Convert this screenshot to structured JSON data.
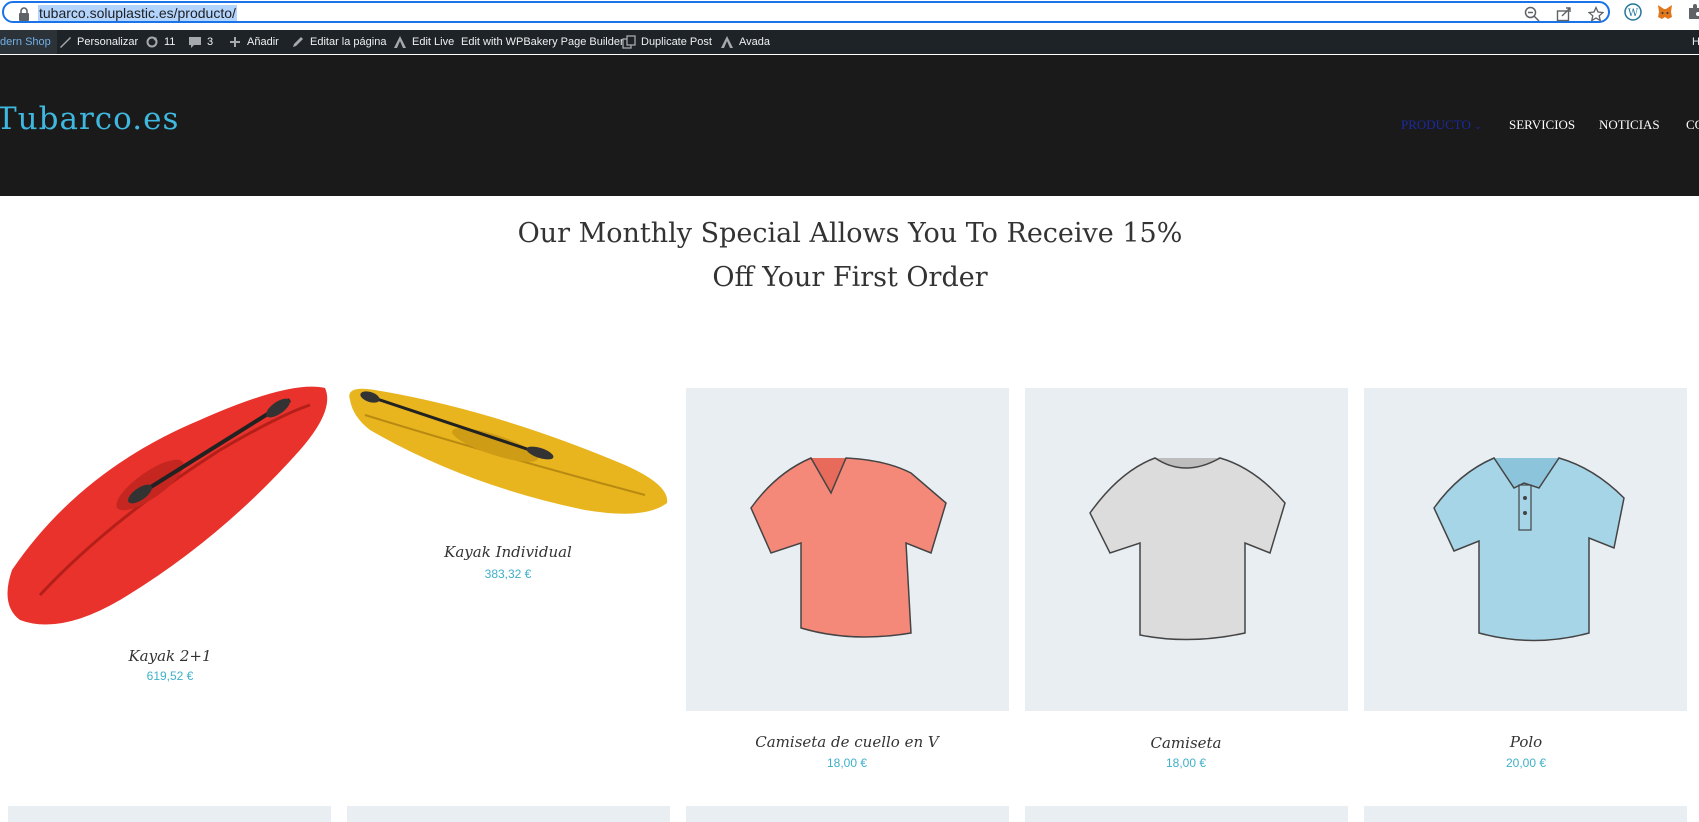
{
  "browser": {
    "url": "tubarco.soluplastic.es/producto/"
  },
  "admin_bar": {
    "shop": "dern Shop",
    "customize": "Personalizar",
    "updates": "11",
    "comments": "3",
    "add_new": "Añadir",
    "edit_page": "Editar la página",
    "edit_live": "Edit Live",
    "wpbakery": "Edit with WPBakery Page Builder",
    "duplicate": "Duplicate Post",
    "avada": "Avada",
    "right_cut": "H"
  },
  "header": {
    "logo": "Tubarco.es",
    "nav": {
      "producto": "PRODUCTO",
      "servicios": "SERVICIOS",
      "noticias": "NOTICIAS",
      "cut": "CO"
    },
    "colors": {
      "background": "#1a1a1a",
      "logo": "#3fb8e0",
      "active": "#1c2aa0"
    }
  },
  "main": {
    "headline_line1": "Our Monthly Special Allows You To Receive 15%",
    "headline_line2": "Off Your First Order",
    "products": [
      {
        "name": "Kayak 2+1",
        "price": "619,52 €"
      },
      {
        "name": "Kayak Individual",
        "price": "383,32 €"
      },
      {
        "name": "Camiseta de cuello en V",
        "price": "18,00 €"
      },
      {
        "name": "Camiseta",
        "price": "18,00 €"
      },
      {
        "name": "Polo",
        "price": "20,00 €"
      }
    ]
  }
}
